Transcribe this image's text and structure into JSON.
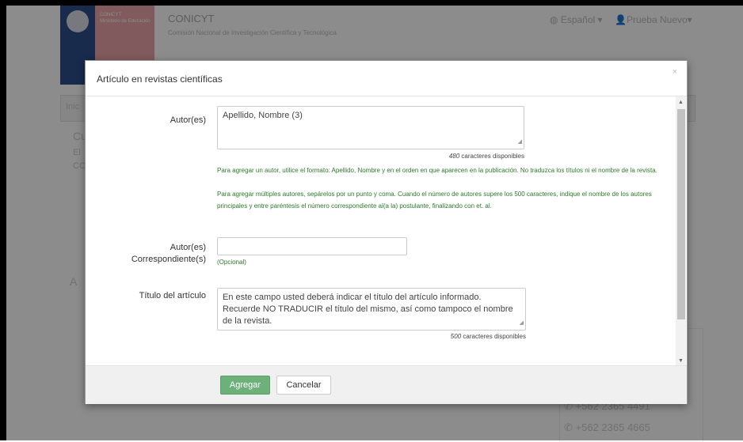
{
  "background": {
    "logo_text": "CONICYT",
    "logo_sub": "Ministerio de Educación",
    "brand": "CONICYT",
    "brand_sub": "Comisión Nacional de Investigación Científica y Tecnológica",
    "language": "Español",
    "user": "Prueba Nuevo",
    "nav_fragment": "Inic",
    "frag_cu": "Cu",
    "frag_el": "El",
    "frag_cc": "CC",
    "frag_a": "A",
    "phones": [
      "+562 2365 4491",
      "+562 2365 4665"
    ]
  },
  "modal": {
    "title": "Artículo en revistas científicas",
    "close_label": "×",
    "authors": {
      "label": "Autor(es)",
      "value": "Apellido, Nombre (3)",
      "counter_num": "480",
      "counter_text": "caracteres disponibles",
      "help1": "Para agregar un autor, utilice el formato: Apellido, Nombre y en el orden en que aparecen en la publicación. No traduzca los títulos ni el nombre de la revista.",
      "help2": "Para agregar múltiples autores, sepárelos por un punto y coma. Cuando el número de autores supere los 500 caracteres, indique el nombre de los autores principales y entre paréntesis el número correspondiente al(a la) postulante, finalizando con et. al."
    },
    "corresponding": {
      "label_line1": "Autor(es)",
      "label_line2": "Correspondiente(s)",
      "value": "",
      "optional": "(Opcional)"
    },
    "article_title": {
      "label": "Título del artículo",
      "value": "En este campo usted deberá indicar el título del artículo informado. Recuerde NO TRADUCIR el título del mismo, así como tampoco el nombre de la revista.",
      "counter_num": "500",
      "counter_text": "caracteres disponibles"
    },
    "footer": {
      "add_label": "Agregar",
      "cancel_label": "Cancelar"
    }
  },
  "colors": {
    "primary_button": "#6cb07a",
    "help_text": "#2b7a2b"
  }
}
